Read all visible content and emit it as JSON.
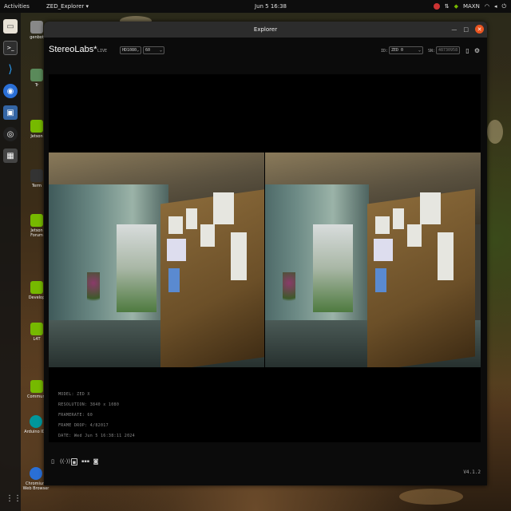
{
  "topbar": {
    "activities": "Activities",
    "app_menu": "ZED_Explorer ▾",
    "clock": "Jun 5 16:38",
    "power_mode": "MAXN"
  },
  "desktop": {
    "icons": [
      {
        "label": "genbot",
        "icon": "folder-icon"
      },
      {
        "label": "Tr",
        "icon": "trash-icon"
      },
      {
        "label": "Jetson",
        "icon": "nvidia-icon"
      },
      {
        "label": "Term",
        "icon": "terminal-icon"
      },
      {
        "label": "Jetson Forum",
        "icon": "nvidia-icon"
      },
      {
        "label": "Develop",
        "icon": "nvidia-icon"
      },
      {
        "label": "L4T",
        "icon": "nvidia-icon"
      },
      {
        "label": "Communi",
        "icon": "nvidia-icon"
      },
      {
        "label": "Arduino IDE",
        "icon": "arduino-icon"
      },
      {
        "label": "Chromium Web Browser",
        "icon": "chromium-icon"
      }
    ]
  },
  "window": {
    "title": "Explorer",
    "brand": "StereoLabs*",
    "mode": "LIVE",
    "resolution_select": "HD1080",
    "fps_select": "60",
    "id_label": "ID:",
    "id_select": "ZED 0",
    "sn_label": "SN:",
    "sn_value": "48730958",
    "info": {
      "model": "MODEL: ZED X",
      "resolution": "RESOLUTION: 3840 x 1080",
      "framerate": "FRAMERATE: 60",
      "frame_drop": "FRAME DROP: 4/82017",
      "date": "DATE: Wed Jun 5 16:38:11 2024"
    },
    "version": "V4.1.2"
  },
  "colors": {
    "accent": "#e95420",
    "nvidia_green": "#76b900"
  }
}
